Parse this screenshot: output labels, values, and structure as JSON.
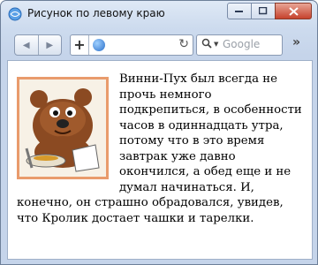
{
  "window": {
    "title": "Рисунок по левому краю",
    "controls": [
      "minimize",
      "maximize",
      "close"
    ]
  },
  "toolbar": {
    "search_placeholder": "Google"
  },
  "content": {
    "article_text": "Винни-Пух был всегда не прочь немного подкрепиться, в особенности часов в одиннадцать утра, потому что в это время завтрак уже давно окончился, а обед еще и не думал начинаться. И, конечно, он страшно обрадовался, увидев, что Кролик достает чашки и тарелки."
  },
  "colors": {
    "image_frame": "#e99b6c",
    "close_button": "#c6422d"
  }
}
